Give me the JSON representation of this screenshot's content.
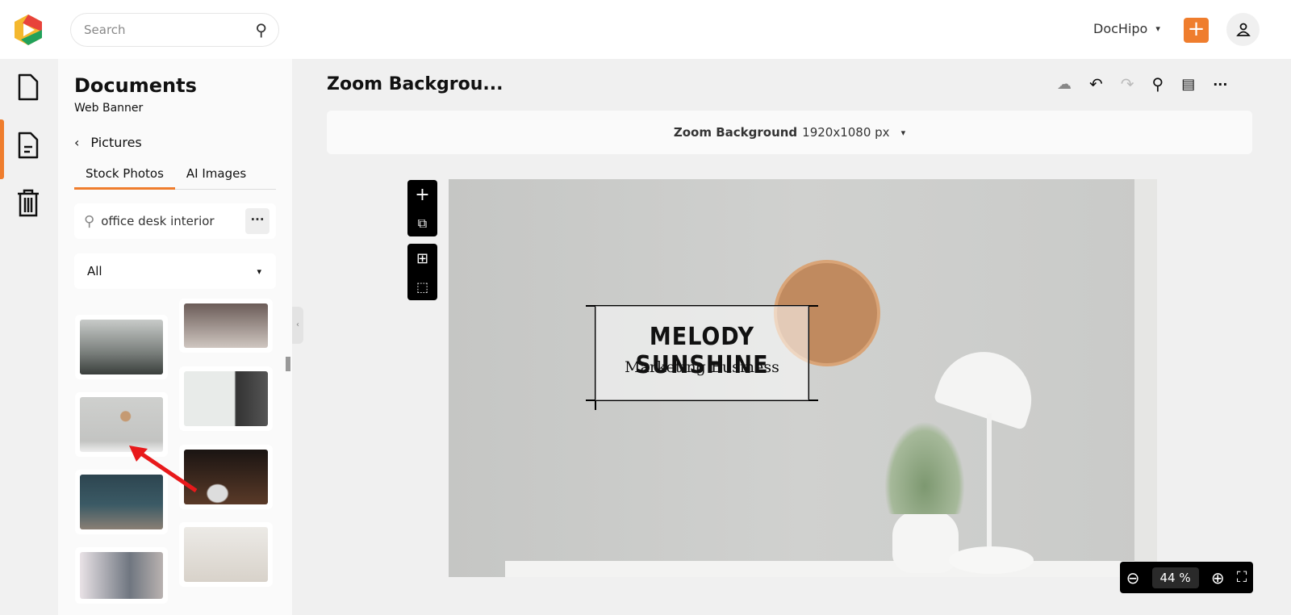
{
  "header": {
    "search_placeholder": "Search",
    "brand": "DocHipo",
    "accent": "#ef7d2d"
  },
  "panel": {
    "title": "Documents",
    "subtitle": "Web Banner",
    "back_label": "Pictures",
    "tabs": [
      {
        "label": "Stock Photos",
        "active": true
      },
      {
        "label": "AI Images",
        "active": false
      }
    ],
    "search_value": "office desk interior",
    "filter": "All"
  },
  "editor": {
    "doc_title": "Zoom Backgrou...",
    "size_name": "Zoom Background",
    "size_dims": "1920x1080 px",
    "zoom_value": "44",
    "zoom_unit": "%"
  },
  "canvas": {
    "name": "MELODY SUNSHINE",
    "tagline": "Marketing Business"
  }
}
